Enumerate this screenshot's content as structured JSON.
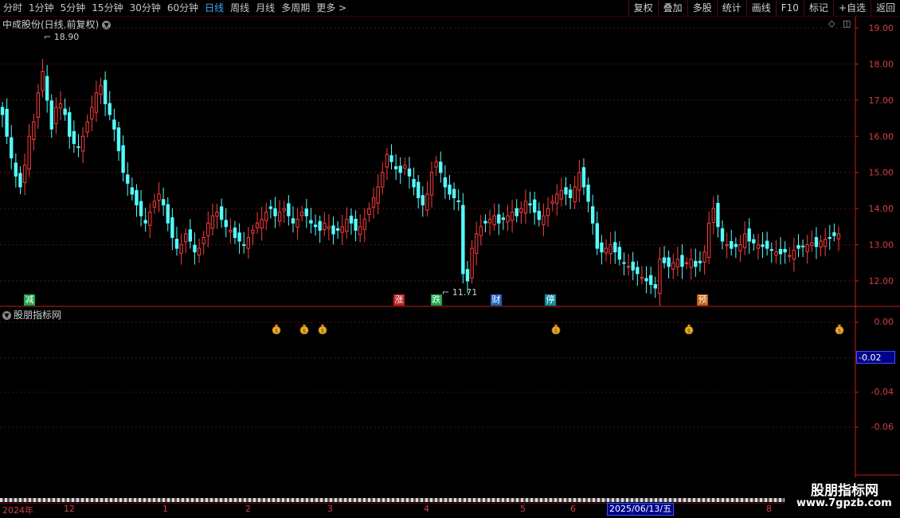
{
  "toolbar": {
    "periods": [
      "分时",
      "1分钟",
      "5分钟",
      "15分钟",
      "30分钟",
      "60分钟",
      "日线",
      "周线",
      "月线",
      "多周期",
      "更多 >"
    ],
    "active_period": "日线",
    "right_buttons": [
      "复权",
      "叠加",
      "多股",
      "统计",
      "画线",
      "F10",
      "标记",
      "+自选",
      "返回"
    ]
  },
  "main_chart": {
    "title": "中成股份(日线,前复权)",
    "high_label": "18.90",
    "low_label": "11.71",
    "events": [
      {
        "text": "减",
        "color": "#1aa84a"
      },
      {
        "text": "涨",
        "color": "#c02020"
      },
      {
        "text": "跌",
        "color": "#1aa84a"
      },
      {
        "text": "财",
        "color": "#2060c0"
      },
      {
        "text": "停",
        "color": "#1090a0"
      },
      {
        "text": "预",
        "color": "#c06010"
      }
    ]
  },
  "indicator": {
    "title": "股朋指标网",
    "axis": [
      "0.00",
      "-0.02",
      "-0.04",
      "-0.06"
    ],
    "current_value": "-0.02",
    "signal_count": 6
  },
  "dates": {
    "labels": [
      "2024年",
      "12",
      "1",
      "2",
      "3",
      "4",
      "5",
      "6",
      "8"
    ],
    "current": "2025/06/13/五"
  },
  "watermark": {
    "title": "股朋指标网",
    "url": "www.7gpzb.com"
  },
  "colors": {
    "up": "#ff3c3c",
    "down": "#54ffff",
    "axis": "#c02020",
    "grid": "#5a1010"
  },
  "chart_data": {
    "type": "candlestick",
    "ylim": [
      11.6,
      19.2
    ],
    "yticks": [
      12.0,
      13.0,
      14.0,
      15.0,
      16.0,
      17.0,
      18.0,
      19.0
    ],
    "close": [
      16.6,
      16.0,
      15.4,
      14.9,
      14.6,
      15.2,
      16.0,
      16.4,
      17.2,
      17.8,
      17.0,
      16.2,
      16.8,
      16.9,
      16.6,
      16.0,
      15.8,
      15.7,
      16.0,
      16.4,
      16.8,
      17.2,
      17.4,
      16.9,
      16.6,
      16.2,
      15.6,
      15.0,
      14.7,
      14.4,
      14.1,
      13.8,
      13.6,
      13.9,
      14.2,
      14.4,
      14.1,
      13.6,
      13.2,
      12.9,
      13.0,
      13.3,
      13.1,
      12.8,
      12.9,
      13.2,
      13.6,
      13.8,
      13.9,
      13.7,
      13.5,
      13.4,
      13.2,
      13.1,
      13.0,
      13.2,
      13.4,
      13.6,
      13.7,
      13.9,
      14.0,
      13.8,
      13.9,
      14.0,
      13.8,
      13.6,
      13.7,
      13.9,
      13.8,
      13.6,
      13.5,
      13.4,
      13.6,
      13.5,
      13.3,
      13.4,
      13.5,
      13.7,
      13.6,
      13.4,
      13.5,
      13.7,
      14.0,
      14.3,
      14.6,
      15.0,
      15.5,
      15.3,
      15.1,
      15.0,
      15.2,
      14.9,
      14.6,
      14.3,
      14.1,
      14.4,
      15.0,
      15.3,
      15.0,
      14.6,
      14.4,
      14.3,
      14.2,
      12.2,
      12.0,
      12.9,
      13.3,
      13.5,
      13.6,
      13.7,
      13.8,
      13.6,
      13.7,
      13.8,
      13.9,
      13.8,
      14.0,
      14.2,
      14.1,
      13.9,
      13.7,
      13.8,
      14.0,
      14.2,
      14.4,
      14.5,
      14.4,
      14.3,
      14.6,
      15.0,
      14.6,
      14.2,
      13.6,
      12.9,
      12.8,
      12.9,
      13.0,
      12.8,
      12.6,
      12.5,
      12.4,
      12.3,
      12.2,
      12.1,
      12.0,
      11.9,
      11.8,
      12.6,
      12.5,
      12.4,
      12.5,
      12.6,
      12.4,
      12.5,
      12.6,
      12.4,
      12.5,
      12.8,
      13.6,
      14.0,
      13.5,
      13.1,
      13.0,
      12.9,
      12.95,
      13.0,
      13.3,
      13.1,
      13.05,
      13.0,
      12.95,
      12.9,
      12.85,
      12.8,
      12.75,
      12.8,
      12.7,
      12.85,
      12.9,
      12.95,
      13.0,
      13.05,
      12.95,
      13.1,
      13.15,
      13.2,
      13.25,
      13.3
    ],
    "events_text": [
      "减",
      "涨",
      "跌",
      "财",
      "停",
      "预"
    ]
  }
}
